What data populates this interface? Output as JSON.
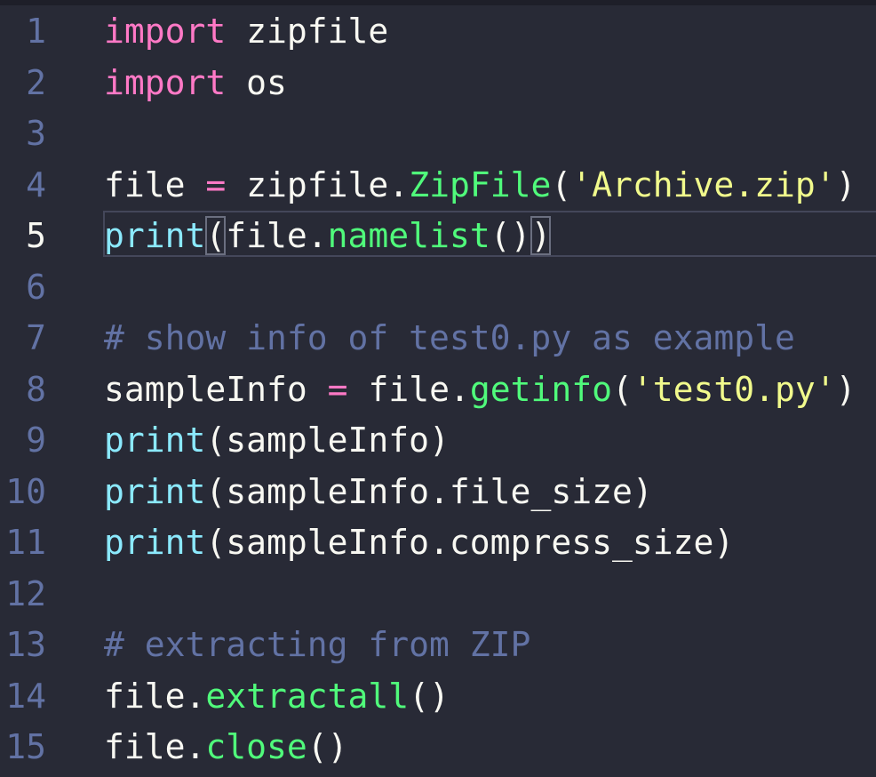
{
  "editor": {
    "lines": [
      {
        "number": "1",
        "tokens": [
          {
            "t": "import",
            "c": "kw"
          },
          {
            "t": " zipfile",
            "c": "pl"
          }
        ]
      },
      {
        "number": "2",
        "tokens": [
          {
            "t": "import",
            "c": "kw"
          },
          {
            "t": " os",
            "c": "pl"
          }
        ]
      },
      {
        "number": "3",
        "tokens": []
      },
      {
        "number": "4",
        "tokens": [
          {
            "t": "file ",
            "c": "pl"
          },
          {
            "t": "=",
            "c": "op"
          },
          {
            "t": " zipfile.",
            "c": "pl"
          },
          {
            "t": "ZipFile",
            "c": "fn"
          },
          {
            "t": "(",
            "c": "pl"
          },
          {
            "t": "'Archive.zip'",
            "c": "str"
          },
          {
            "t": ")",
            "c": "pl"
          }
        ]
      },
      {
        "number": "5",
        "active": true,
        "tokens": [
          {
            "t": "print",
            "c": "bi"
          },
          {
            "t": "(",
            "c": "pl",
            "box": true
          },
          {
            "t": "file.",
            "c": "pl"
          },
          {
            "t": "namelist",
            "c": "fn"
          },
          {
            "t": "()",
            "c": "pl"
          },
          {
            "t": ")",
            "c": "pl",
            "box": true
          }
        ]
      },
      {
        "number": "6",
        "tokens": []
      },
      {
        "number": "7",
        "tokens": [
          {
            "t": "# show info of test0.py as example",
            "c": "cm"
          }
        ]
      },
      {
        "number": "8",
        "tokens": [
          {
            "t": "sampleInfo ",
            "c": "pl"
          },
          {
            "t": "=",
            "c": "op"
          },
          {
            "t": " file.",
            "c": "pl"
          },
          {
            "t": "getinfo",
            "c": "fn"
          },
          {
            "t": "(",
            "c": "pl"
          },
          {
            "t": "'test0.py'",
            "c": "str"
          },
          {
            "t": ")",
            "c": "pl"
          }
        ]
      },
      {
        "number": "9",
        "tokens": [
          {
            "t": "print",
            "c": "bi"
          },
          {
            "t": "(sampleInfo)",
            "c": "pl"
          }
        ]
      },
      {
        "number": "10",
        "tokens": [
          {
            "t": "print",
            "c": "bi"
          },
          {
            "t": "(sampleInfo.file_size)",
            "c": "pl"
          }
        ]
      },
      {
        "number": "11",
        "tokens": [
          {
            "t": "print",
            "c": "bi"
          },
          {
            "t": "(sampleInfo.compress_size)",
            "c": "pl"
          }
        ]
      },
      {
        "number": "12",
        "tokens": []
      },
      {
        "number": "13",
        "tokens": [
          {
            "t": "# extracting from ZIP",
            "c": "cm"
          }
        ]
      },
      {
        "number": "14",
        "tokens": [
          {
            "t": "file.",
            "c": "pl"
          },
          {
            "t": "extractall",
            "c": "fn"
          },
          {
            "t": "()",
            "c": "pl"
          }
        ]
      },
      {
        "number": "15",
        "tokens": [
          {
            "t": "file.",
            "c": "pl"
          },
          {
            "t": "close",
            "c": "fn"
          },
          {
            "t": "()",
            "c": "pl"
          }
        ]
      }
    ]
  },
  "colors": {
    "background": "#282a36",
    "keyword": "#ff79c6",
    "builtin": "#8be9fd",
    "function": "#50fa7b",
    "string": "#f1fa8c",
    "comment": "#6272a4",
    "plain": "#f8f8f2"
  }
}
